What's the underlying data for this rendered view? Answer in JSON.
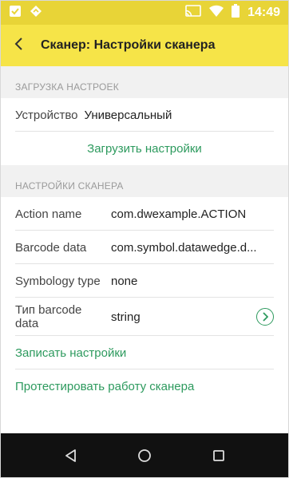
{
  "status_bar": {
    "time": "14:49",
    "left_icons": [
      "checkbox-icon",
      "navigation-diamond-icon"
    ],
    "right_icons": [
      "cast-icon",
      "wifi-icon",
      "battery-icon"
    ]
  },
  "toolbar": {
    "title": "Сканер: Настройки сканера",
    "background": "#f6e448"
  },
  "load_section": {
    "header": "ЗАГРУЗКА НАСТРОЕК",
    "device_label": "Устройство",
    "device_value": "Универсальный",
    "load_button": "Загрузить настройки"
  },
  "scanner_section": {
    "header": "НАСТРОЙКИ СКАНЕРА",
    "rows": [
      {
        "label": "Action name",
        "value": "com.dwexample.ACTION"
      },
      {
        "label": "Barcode data",
        "value": "com.symbol.datawedge.d..."
      },
      {
        "label": "Symbology type",
        "value": "none"
      },
      {
        "label": "Тип barcode data",
        "value": "string"
      }
    ]
  },
  "actions": {
    "save": "Записать настройки",
    "test": "Протестировать работу сканера"
  },
  "accent_color": "#2d9a5e",
  "nav_bar": {
    "buttons": [
      "back-triangle-icon",
      "home-circle-icon",
      "recents-square-icon"
    ]
  }
}
